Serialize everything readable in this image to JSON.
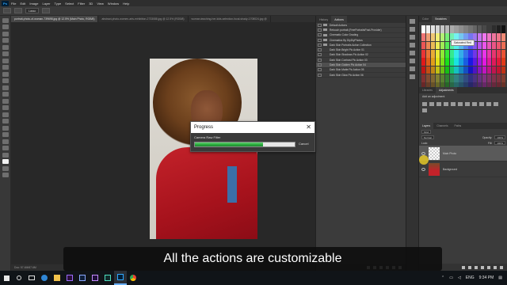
{
  "app": {
    "logo": "Ps"
  },
  "menu": [
    "File",
    "Edit",
    "Image",
    "Layer",
    "Type",
    "Select",
    "Filter",
    "3D",
    "View",
    "Window",
    "Help"
  ],
  "options": {
    "mode": "Lasso"
  },
  "tabs": [
    "portrait-photo-of-woman-739698.jpg @ 12.5% (Main Photo, RGB/8)",
    "abstract-photo-women-arts-exhibition-2733088.jpg @ 12.5% (RGB/8)",
    "woman-teaching-her-kids-selection-focal-shady-1708024.jpg @"
  ],
  "status": {
    "text": "Doc: 57.4M/67.6M"
  },
  "actions_panel": {
    "tabs": [
      "History",
      "Actions"
    ],
    "rows": [
      {
        "label": "Default Actions",
        "level": 0,
        "selected": false
      },
      {
        "label": "Retouch portrait (FreePortraitsPost-Provider)",
        "level": 0,
        "selected": false
      },
      {
        "label": "Cinematic Color Grading",
        "level": 0,
        "selected": false
      },
      {
        "label": "Cinematics By DiyDiyPhotos",
        "level": 0,
        "selected": false
      },
      {
        "label": "Dark Skin Portraits Action Collection",
        "level": 0,
        "selected": false
      },
      {
        "label": "Dark Skin Bright Pic Action 01",
        "level": 1,
        "selected": false
      },
      {
        "label": "Dark Skin Shadows Pic Action 02",
        "level": 1,
        "selected": false
      },
      {
        "label": "Dark Skin Contrast Pic Action 03",
        "level": 1,
        "selected": false
      },
      {
        "label": "Dark Skin Golden Pic Action 04",
        "level": 1,
        "selected": true
      },
      {
        "label": "Dark Skin Matte Pic Action 05",
        "level": 1,
        "selected": false
      },
      {
        "label": "Dark Skin Glow Pic Action 06",
        "level": 1,
        "selected": false
      }
    ]
  },
  "right_panel": {
    "tabs": [
      "Color",
      "Swatches"
    ],
    "tooltip": "Saturated Red",
    "adjustments_tabs": [
      "Libraries",
      "Adjustments"
    ],
    "add_adjustment_label": "Add an adjustment",
    "layers_tabs": [
      "Layers",
      "Channels",
      "Paths"
    ],
    "kind_label": "Kind",
    "blend_mode": "Normal",
    "opacity_label": "Opacity:",
    "opacity_value": "100%",
    "lock_label": "Lock:",
    "fill_label": "Fill:",
    "fill_value": "100%",
    "layers": [
      {
        "name": "Main Photo",
        "selected": true
      },
      {
        "name": "Background",
        "selected": false
      }
    ]
  },
  "dialog": {
    "title": "Progress",
    "close": "✕",
    "label": "Camera Raw Filter",
    "progress": 0.68,
    "cancel_label": "Cancel"
  },
  "caption": {
    "text": "All the actions are customizable"
  },
  "taskbar": {
    "lang": "ENG",
    "time": "9:34 PM",
    "icons": [
      "windows-start-icon",
      "search-icon",
      "task-view-icon",
      "edge-icon",
      "file-explorer-icon",
      "premiere-icon",
      "media-encoder-icon",
      "after-effects-icon",
      "audition-icon",
      "photoshop-icon",
      "chrome-icon"
    ]
  },
  "colors": {
    "accent": "#31a8ff",
    "progress_green": "#2aa83c",
    "panel": "#3b3b3b",
    "canvas": "#282828"
  }
}
